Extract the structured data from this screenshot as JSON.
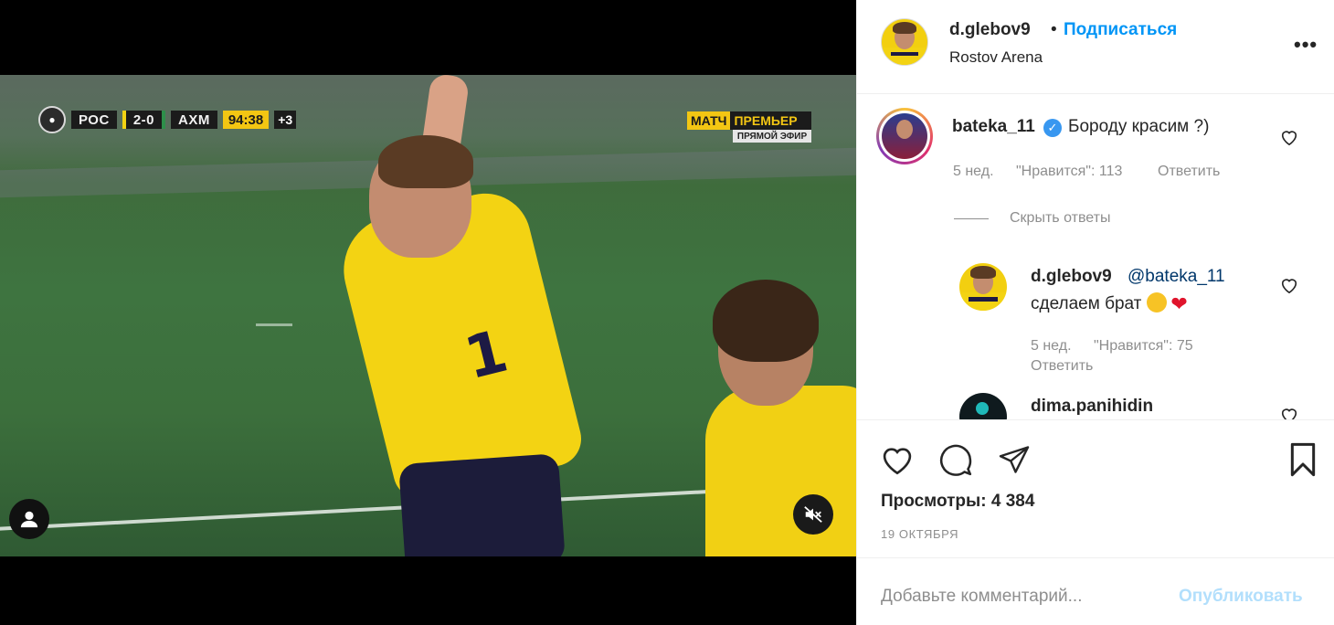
{
  "video": {
    "scoreboard": {
      "home_team": "РОС",
      "score": "2-0",
      "away_team": "АХМ",
      "clock": "94:38",
      "added_time": "+3"
    },
    "channel": {
      "match": "МАТЧ",
      "premier": "ПРЕМЬЕР",
      "live": "ПРЯМОЙ ЭФИР"
    },
    "player_number": "1"
  },
  "header": {
    "username": "d.glebov9",
    "separator": "•",
    "follow_label": "Подписаться",
    "location": "Rostov Arena",
    "more_label": "•••"
  },
  "comments": [
    {
      "username": "bateka_11",
      "verified": true,
      "text": "Бороду красим ?)",
      "age": "5 нед.",
      "likes": "\"Нравится\": 113",
      "reply_label": "Ответить"
    }
  ],
  "hide_replies_label": "Скрыть ответы",
  "replies": [
    {
      "username": "d.glebov9",
      "mention": "@bateka_11",
      "text": "сделаем брат",
      "age": "5 нед.",
      "likes": "\"Нравится\": 75",
      "reply_label": "Ответить"
    },
    {
      "username": "dima.panihidin"
    }
  ],
  "stats": {
    "views": "Просмотры: 4 384",
    "date": "19 ОКТЯБРЯ"
  },
  "composer": {
    "placeholder": "Добавьте комментарий...",
    "publish_label": "Опубликовать"
  },
  "colors": {
    "link_blue": "#0095f6",
    "publish_disabled": "#b2dffc",
    "muted_text": "#8e8e8e",
    "jersey_yellow": "#f3d313"
  }
}
